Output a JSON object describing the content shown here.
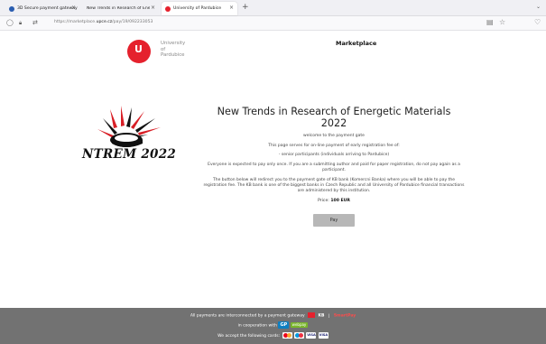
{
  "browser": {
    "tabs": [
      {
        "title": "3D Secure payment gateway",
        "icon": "globe-icon",
        "color": "#2a5db0"
      },
      {
        "title": "New Trends in Research of Energeti",
        "icon": "",
        "color": ""
      },
      {
        "title": "University of Pardubice",
        "icon": "upce-logo-icon",
        "color": "#e5212d"
      }
    ],
    "new_tab": "+",
    "url_prefix": "https://marketplace.",
    "url_domain": "upce.cz",
    "url_path": "/pay/19/092233053"
  },
  "header": {
    "logo_lines": [
      "University",
      "of",
      "Pardubice"
    ],
    "logo_letter": "U",
    "marketplace": "Marketplace"
  },
  "event_logo": "NTREM 2022",
  "content": {
    "title": "New Trends in Research of Energetic Materials 2022",
    "welcome": "welcome to the payment gate",
    "intro": "This page serves for on-line payment of early registration fee of:",
    "participants": "- senior participants (individuals arriving to Pardubice)",
    "notice": "Everyone is expected to pay only once. If you are a submitting author and paid for paper registration, do not pay again as a participant.",
    "redirect": "The button below will redirect you to the payment gate of KB bank (Komercni Banka) where you will be able to pay the registration fee. The KB bank is one of the biggest banks in Czech Republic and all University of Pardubice financial transactions are administered by this institution.",
    "price_label": "Price:",
    "price_value": "100 EUR",
    "pay_button": "Pay"
  },
  "footer": {
    "line1": "All payments are interconnected by a payment gateway",
    "kb": "KB",
    "separator": "|",
    "smartpay": "SmartPay",
    "line2": "in cooperation with",
    "gp": "GP",
    "webpay": "webpay",
    "line3": "We accept the following cards:",
    "visa1": "VISA",
    "visa2": "VISA"
  },
  "colors": {
    "brand_red": "#e5212d",
    "footer_bg": "#727272",
    "button": "#b7b7b7"
  }
}
